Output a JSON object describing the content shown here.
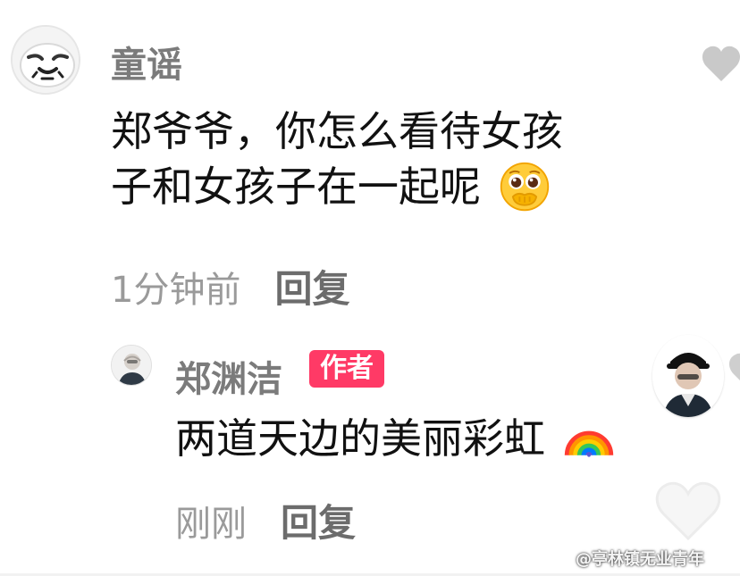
{
  "comments": {
    "root": {
      "username": "童谣",
      "text_line_1": "郑爷爷，你怎么看待女孩",
      "text_line_2": "子和女孩子在一起呢",
      "emoji": "pleading-face-with-hands-emoji",
      "time": "1分钟前",
      "reply_label": "回复",
      "avatar_icon": "meme-face-avatar",
      "like_icon": "heart-icon"
    },
    "reply": {
      "username": "郑渊洁",
      "badge": "作者",
      "text": "两道天边的美丽彩虹",
      "emoji": "rainbow-emoji",
      "time": "刚刚",
      "reply_label": "回复",
      "avatar_icon": "elderly-man-avatar",
      "like_icon": "heart-icon"
    }
  },
  "overlay": {
    "watermark_text": "@亭林镇无业青年",
    "watermark_icon": "weibo-icon",
    "corner_avatar_icon": "person-with-cap-avatar"
  },
  "colors": {
    "badge_bg": "#ff3a66",
    "username": "#7b7b7b",
    "meta": "#9a9a9a"
  }
}
